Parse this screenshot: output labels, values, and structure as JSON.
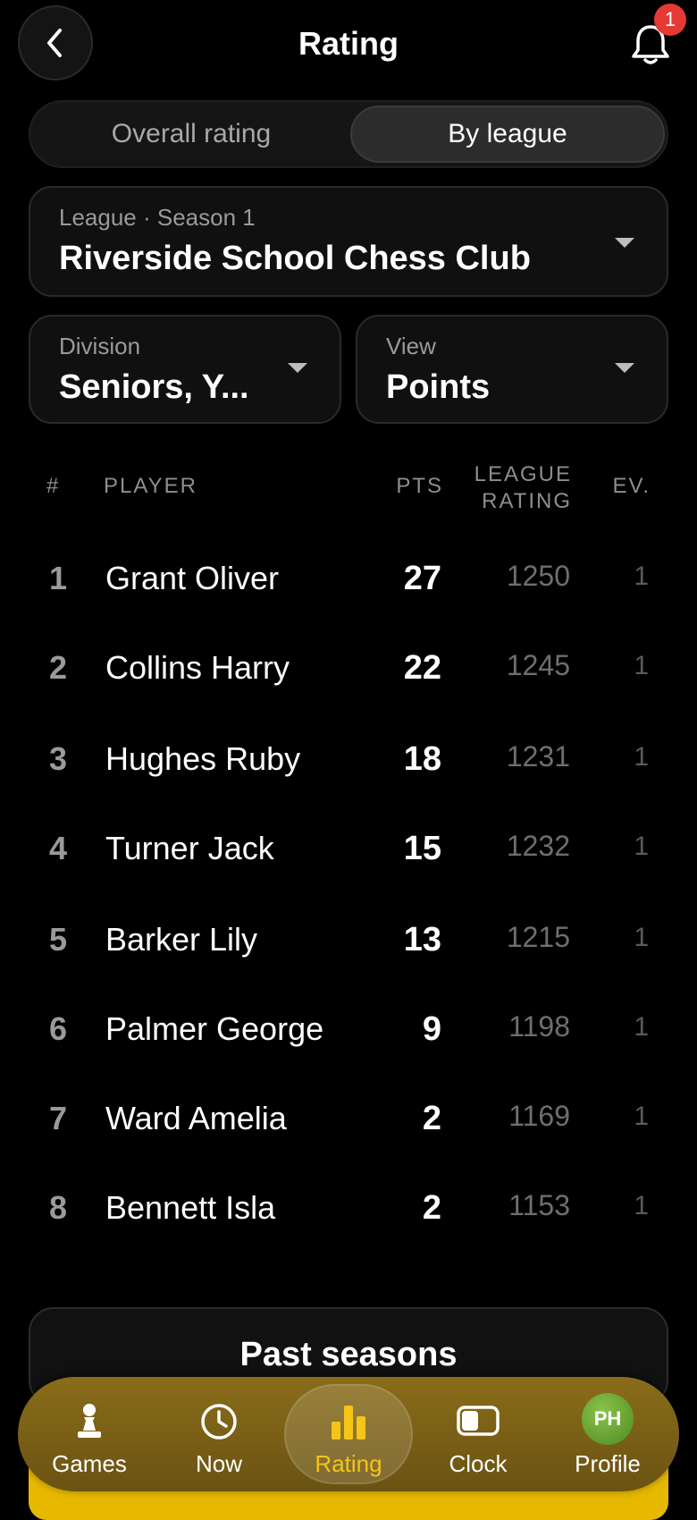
{
  "header": {
    "title": "Rating",
    "notifications_count": "1"
  },
  "tabs": {
    "overall": "Overall rating",
    "by_league": "By league",
    "selected": "By league"
  },
  "league_select": {
    "label": "League · Season 1",
    "value": "Riverside School Chess Club"
  },
  "division_select": {
    "label": "Division",
    "value": "Seniors, Y..."
  },
  "view_select": {
    "label": "View",
    "value": "Points"
  },
  "table": {
    "headers": {
      "rank": "#",
      "player": "PLAYER",
      "pts": "PTS",
      "rating_line1": "LEAGUE",
      "rating_line2": "RATING",
      "events": "EV."
    },
    "rows": [
      {
        "rank": "1",
        "name": "Grant Oliver",
        "pts": "27",
        "rating": "1250",
        "ev": "1"
      },
      {
        "rank": "2",
        "name": "Collins Harry",
        "pts": "22",
        "rating": "1245",
        "ev": "1"
      },
      {
        "rank": "3",
        "name": "Hughes Ruby",
        "pts": "18",
        "rating": "1231",
        "ev": "1"
      },
      {
        "rank": "4",
        "name": "Turner Jack",
        "pts": "15",
        "rating": "1232",
        "ev": "1"
      },
      {
        "rank": "5",
        "name": "Barker Lily",
        "pts": "13",
        "rating": "1215",
        "ev": "1"
      },
      {
        "rank": "6",
        "name": "Palmer George",
        "pts": "9",
        "rating": "1198",
        "ev": "1"
      },
      {
        "rank": "7",
        "name": "Ward Amelia",
        "pts": "2",
        "rating": "1169",
        "ev": "1"
      },
      {
        "rank": "8",
        "name": "Bennett Isla",
        "pts": "2",
        "rating": "1153",
        "ev": "1"
      }
    ]
  },
  "past_seasons_label": "Past seasons",
  "bottom_nav": {
    "games": "Games",
    "now": "Now",
    "rating": "Rating",
    "clock": "Clock",
    "profile": "Profile",
    "profile_initials": "PH",
    "active": "Rating"
  },
  "colors": {
    "accent": "#F5C518",
    "badge": "#E53935",
    "nav_bg": "#7A5F16"
  }
}
